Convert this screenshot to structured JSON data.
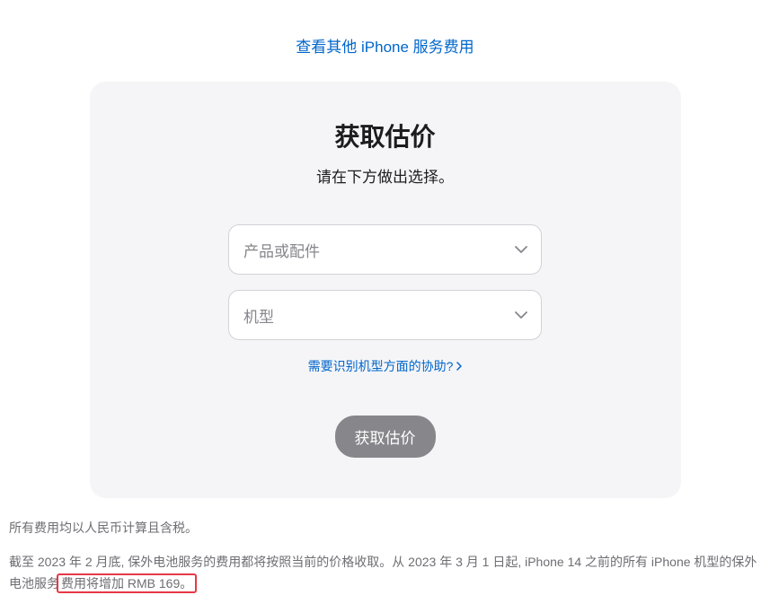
{
  "topLink": {
    "text": "查看其他 iPhone 服务费用"
  },
  "card": {
    "title": "获取估价",
    "subtitle": "请在下方做出选择。",
    "select1": {
      "placeholder": "产品或配件"
    },
    "select2": {
      "placeholder": "机型"
    },
    "helpLink": "需要识别机型方面的协助?",
    "submitLabel": "获取估价"
  },
  "footer": {
    "line1": "所有费用均以人民币计算且含税。",
    "line2_part1": "截至 2023 年 2 月底, 保外电池服务的费用都将按照当前的价格收取。从 2023 年 3 月 1 日起, iPhone 14 之前的所有 iPhone 机型的保外电池服务",
    "line2_highlight": "费用将增加 RMB 169。"
  }
}
